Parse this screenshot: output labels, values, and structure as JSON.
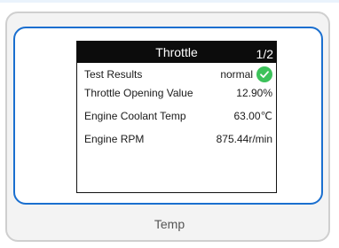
{
  "screen": {
    "title": "Throttle",
    "page": "1/2",
    "rows": [
      {
        "label": "Test Results",
        "value": "normal"
      },
      {
        "label": "Throttle Opening Value",
        "value": "12.90%"
      },
      {
        "label": "Engine Coolant Temp",
        "value": "63.00℃"
      },
      {
        "label": "Engine RPM",
        "value": "875.44r/min"
      }
    ],
    "status_icon": "check-circle-icon"
  },
  "caption": "Temp",
  "colors": {
    "frame_border": "#1a6fcf",
    "header_bg": "#0c0c0c",
    "status_ok": "#3cc25a"
  }
}
